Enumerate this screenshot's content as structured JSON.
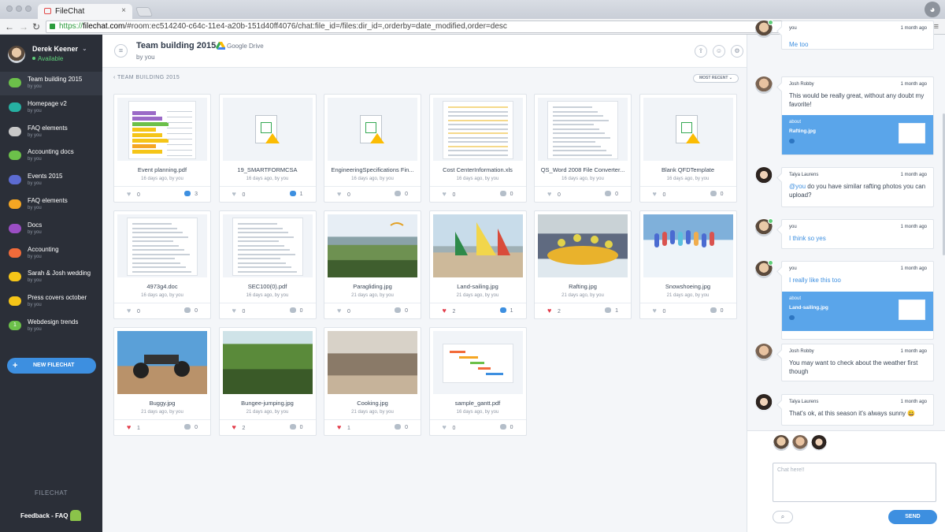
{
  "browser": {
    "tab_title": "FileChat",
    "url_scheme": "https://",
    "url_host": "filechat.com",
    "url_path": "/#room:ec514240-c64c-11e4-a20b-151d40ff4076/chat:file_id=/files:dir_id=,orderby=date_modified,order=desc"
  },
  "sidebar": {
    "user_name": "Derek Keener",
    "user_status": "Available",
    "items": [
      {
        "label": "Team building 2015",
        "sub": "by you",
        "color": "#6cc04a"
      },
      {
        "label": "Homepage v2",
        "sub": "by you",
        "color": "#26b0a2"
      },
      {
        "label": "FAQ elements",
        "sub": "by you",
        "color": "#c8c8c8"
      },
      {
        "label": "Accounting docs",
        "sub": "by you",
        "color": "#6cc04a"
      },
      {
        "label": "Events 2015",
        "sub": "by you",
        "color": "#5c6bd1"
      },
      {
        "label": "FAQ elements",
        "sub": "by you",
        "color": "#f5a623"
      },
      {
        "label": "Docs",
        "sub": "by you",
        "color": "#9b4ec4"
      },
      {
        "label": "Accounting",
        "sub": "by you",
        "color": "#f26b3a"
      },
      {
        "label": "Sarah & Josh wedding",
        "sub": "by you",
        "color": "#f5c518"
      },
      {
        "label": "Press covers october",
        "sub": "by you",
        "color": "#f5c518"
      },
      {
        "label": "Webdesign trends",
        "sub": "by you",
        "color": "#6cc04a",
        "badge": "1"
      }
    ],
    "new_chat_label": "NEW FILECHAT",
    "brand": "FILECHAT",
    "feedback": "Feedback - FAQ -"
  },
  "main": {
    "title": "Team building 2015",
    "subtitle": "by you",
    "source": "Google Drive",
    "breadcrumb": "TEAM BUILDING 2015",
    "sort_label": "MOST RECENT",
    "files": [
      {
        "name": "Event planning.pdf",
        "meta": "16 days ago, by you",
        "likes": "0",
        "comments": "3",
        "liked": false,
        "has_comments": true,
        "kind": "gantt-color"
      },
      {
        "name": "19_SMARTFORMCSA",
        "meta": "16 days ago, by you",
        "likes": "0",
        "comments": "1",
        "liked": false,
        "has_comments": true,
        "kind": "gsheet"
      },
      {
        "name": "EngineeringSpecifications Fin...",
        "meta": "16 days ago, by you",
        "likes": "0",
        "comments": "0",
        "liked": false,
        "has_comments": false,
        "kind": "gsheet"
      },
      {
        "name": "Cost CenterInformation.xls",
        "meta": "16 days ago, by you",
        "likes": "0",
        "comments": "0",
        "liked": false,
        "has_comments": false,
        "kind": "sheet"
      },
      {
        "name": "QS_Word 2008 File Converter...",
        "meta": "16 days ago, by you",
        "likes": "0",
        "comments": "0",
        "liked": false,
        "has_comments": false,
        "kind": "doc"
      },
      {
        "name": "Blank QFDTemplate",
        "meta": "16 days ago, by you",
        "likes": "0",
        "comments": "0",
        "liked": false,
        "has_comments": false,
        "kind": "gsheet"
      },
      {
        "name": "4973g4.doc",
        "meta": "16 days ago, by you",
        "likes": "0",
        "comments": "0",
        "liked": false,
        "has_comments": false,
        "kind": "doc"
      },
      {
        "name": "SEC100(0).pdf",
        "meta": "16 days ago, by you",
        "likes": "0",
        "comments": "0",
        "liked": false,
        "has_comments": false,
        "kind": "doc"
      },
      {
        "name": "Paragliding.jpg",
        "meta": "21 days ago, by you",
        "likes": "0",
        "comments": "0",
        "liked": false,
        "has_comments": false,
        "kind": "photo-mountain"
      },
      {
        "name": "Land-sailing.jpg",
        "meta": "21 days ago, by you",
        "likes": "2",
        "comments": "1",
        "liked": true,
        "has_comments": true,
        "kind": "photo-beach"
      },
      {
        "name": "Rafting.jpg",
        "meta": "21 days ago, by you",
        "likes": "2",
        "comments": "1",
        "liked": true,
        "has_comments": false,
        "kind": "photo-raft"
      },
      {
        "name": "Snowshoeing.jpg",
        "meta": "21 days ago, by you",
        "likes": "0",
        "comments": "0",
        "liked": false,
        "has_comments": false,
        "kind": "photo-snow"
      },
      {
        "name": "Buggy.jpg",
        "meta": "21 days ago, by you",
        "likes": "1",
        "comments": "0",
        "liked": true,
        "has_comments": false,
        "kind": "photo-buggy"
      },
      {
        "name": "Bungee-jumping.jpg",
        "meta": "21 days ago, by you",
        "likes": "2",
        "comments": "0",
        "liked": true,
        "has_comments": false,
        "kind": "photo-forest"
      },
      {
        "name": "Cooking.jpg",
        "meta": "21 days ago, by you",
        "likes": "1",
        "comments": "0",
        "liked": true,
        "has_comments": false,
        "kind": "photo-kitchen"
      },
      {
        "name": "sample_gantt.pdf",
        "meta": "16 days ago, by you",
        "likes": "0",
        "comments": "0",
        "liked": false,
        "has_comments": false,
        "kind": "gantt"
      }
    ]
  },
  "chat": {
    "messages": [
      {
        "author": "you",
        "time": "1 month ago",
        "text": "Me too",
        "mine": true,
        "avatar": "derek"
      },
      {
        "author": "Josh Robby",
        "time": "1 month ago",
        "text": "This would be really great, without any doubt my favorite!",
        "mine": false,
        "avatar": "josh",
        "about_title": "about",
        "about_file": "Rafting.jpg"
      },
      {
        "author": "Talya Laurens",
        "time": "1 month ago",
        "mention": "@you",
        "text": " do you have similar rafting photos you can upload?",
        "mine": false,
        "avatar": "talya"
      },
      {
        "author": "you",
        "time": "1 month ago",
        "text": "I think so yes",
        "mine": true,
        "avatar": "derek"
      },
      {
        "author": "you",
        "time": "1 month ago",
        "text": "I really like this too",
        "mine": true,
        "avatar": "derek",
        "about_title": "about",
        "about_file": "Land-sailing.jpg"
      },
      {
        "author": "Josh Robby",
        "time": "1 month ago",
        "text": "You may want to check about the weather first though",
        "mine": false,
        "avatar": "josh"
      },
      {
        "author": "Talya Laurens",
        "time": "1 month ago",
        "text": "That's ok, at this season it's always sunny 😀",
        "mine": false,
        "avatar": "talya"
      }
    ],
    "input_placeholder": "Chat here!!",
    "send_label": "SEND"
  }
}
